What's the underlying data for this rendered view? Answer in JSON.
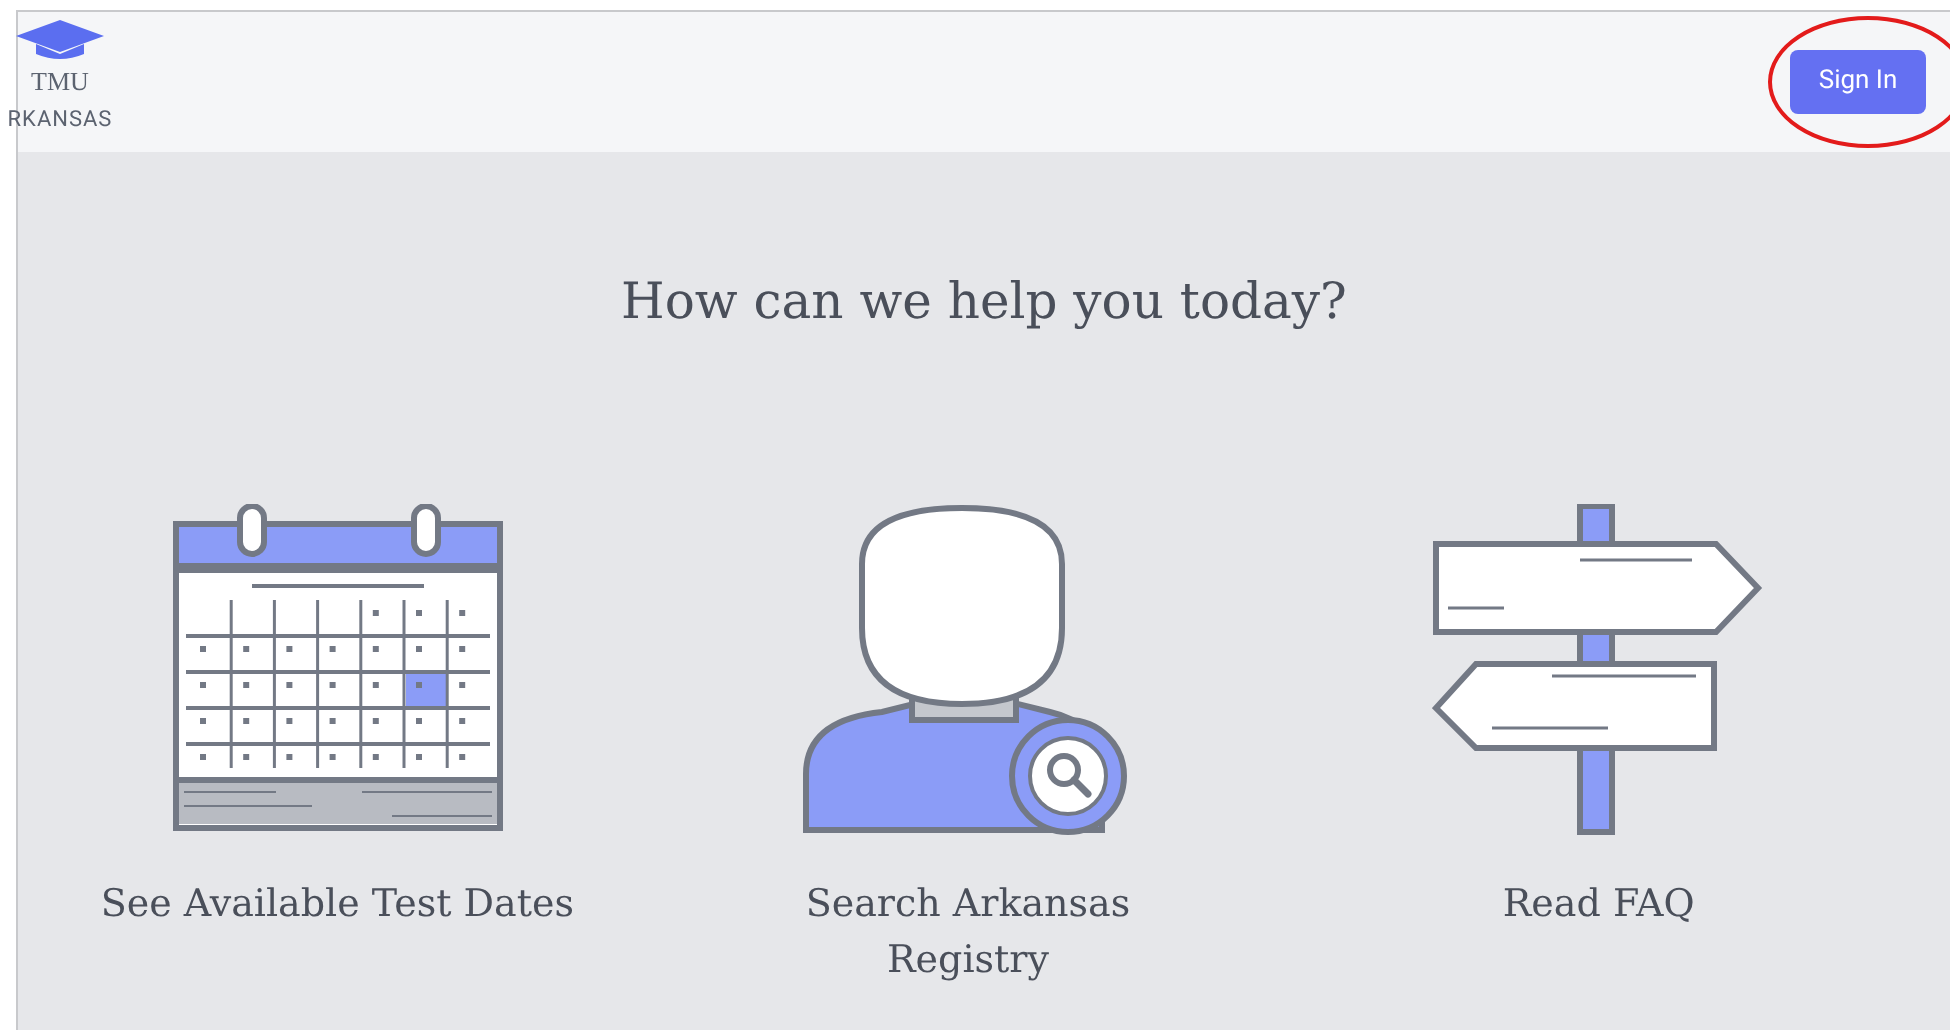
{
  "header": {
    "logo": {
      "abbr": "TMU",
      "name": "RKANSAS"
    },
    "sign_in": "Sign In",
    "sign_in_highlighted": true
  },
  "heading": "How can we help you today?",
  "options": [
    {
      "kind": "calendar",
      "label": "See Available Test Dates"
    },
    {
      "kind": "search",
      "label": "Search Arkansas Registry"
    },
    {
      "kind": "signpost",
      "label": "Read FAQ"
    }
  ]
}
